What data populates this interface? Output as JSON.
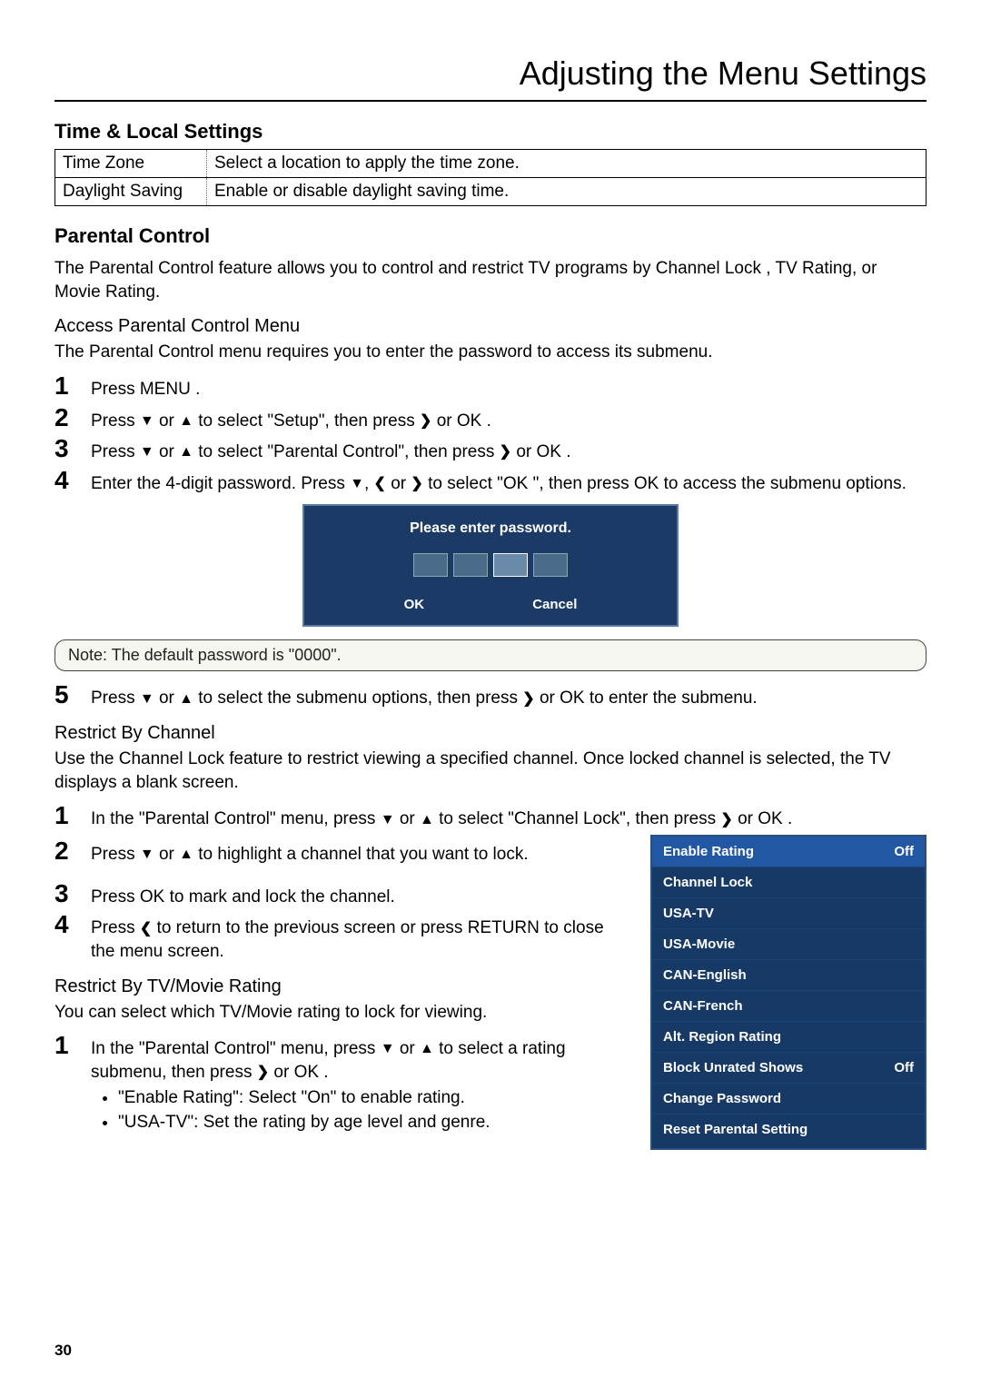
{
  "chapterTitle": "Adjusting the Menu Settings",
  "pageNumber": "30",
  "section1": {
    "heading": "Time & Local Settings",
    "rows": [
      {
        "label": "Time Zone",
        "desc": "Select a location to apply the time zone."
      },
      {
        "label": "Daylight Saving",
        "desc": "Enable or disable daylight saving time."
      }
    ]
  },
  "section2": {
    "heading": "Parental Control",
    "intro": "The Parental Control feature allows you to control and restrict TV programs by Channel Lock , TV Rating, or Movie Rating.",
    "accessHeading": "Access Parental Control Menu",
    "accessIntro": "The Parental Control menu requires you to enter the password to access its submenu.",
    "steps": {
      "s1": "Press MENU  .",
      "s2a": "Press ",
      "s2b": " or ",
      "s2c": "  to select \"Setup\", then press ",
      "s2d": " or OK .",
      "s3a": "Press ",
      "s3b": " or ",
      "s3c": "  to select \"Parental Control\", then press ",
      "s3d": " or OK .",
      "s4a": "Enter the 4-digit password. Press ",
      "s4b": ", ",
      "s4c": " or ",
      "s4d": "  to select \"OK \", then press OK  to access the submenu options.",
      "s5a": "Press ",
      "s5b": " or ",
      "s5c": "  to select the submenu options, then press  ",
      "s5d": " or OK  to enter the submenu."
    }
  },
  "pwDialog": {
    "title": "Please enter password.",
    "ok": "OK",
    "cancel": "Cancel"
  },
  "note": "Note:   The default password is \"0000\".",
  "restrictChannel": {
    "heading": "Restrict By Channel",
    "intro": "Use the Channel Lock feature to restrict viewing a specified channel. Once locked channel is selected, the TV displays a blank screen.",
    "s1a": "In the \"Parental Control\" menu, press ",
    "s1b": " or ",
    "s1c": "  to select \"Channel Lock\", then press ",
    "s1d": " or OK .",
    "s2a": "Press ",
    "s2b": " or ",
    "s2c": " to highlight a channel that you want to lock.",
    "s3": "Press OK  to mark and lock the channel.",
    "s4a": "Press ",
    "s4b": " to return to the previous screen or press RETURN   to close the menu screen."
  },
  "restrictRating": {
    "heading": "Restrict By TV/Movie Rating",
    "intro": "You can select which TV/Movie rating to lock for viewing.",
    "s1a": "In the \"Parental Control\" menu, press ",
    "s1b": " or ",
    "s1c": "  to select a rating submenu, then press ",
    "s1d": " or OK .",
    "b1": "\"Enable Rating\": Select \"On\" to enable rating.",
    "b2": "\"USA-TV\": Set the rating by age level and genre."
  },
  "menuPanel": {
    "items": [
      {
        "label": "Enable Rating",
        "value": "Off"
      },
      {
        "label": "Channel Lock",
        "value": ""
      },
      {
        "label": "USA-TV",
        "value": ""
      },
      {
        "label": "USA-Movie",
        "value": ""
      },
      {
        "label": "CAN-English",
        "value": ""
      },
      {
        "label": "CAN-French",
        "value": ""
      },
      {
        "label": "Alt. Region Rating",
        "value": ""
      },
      {
        "label": "Block Unrated Shows",
        "value": "Off"
      },
      {
        "label": "Change Password",
        "value": ""
      },
      {
        "label": "Reset Parental Setting",
        "value": ""
      }
    ]
  },
  "arrows": {
    "down": "▼",
    "up": "▲",
    "left": "❮",
    "right": "❯"
  }
}
